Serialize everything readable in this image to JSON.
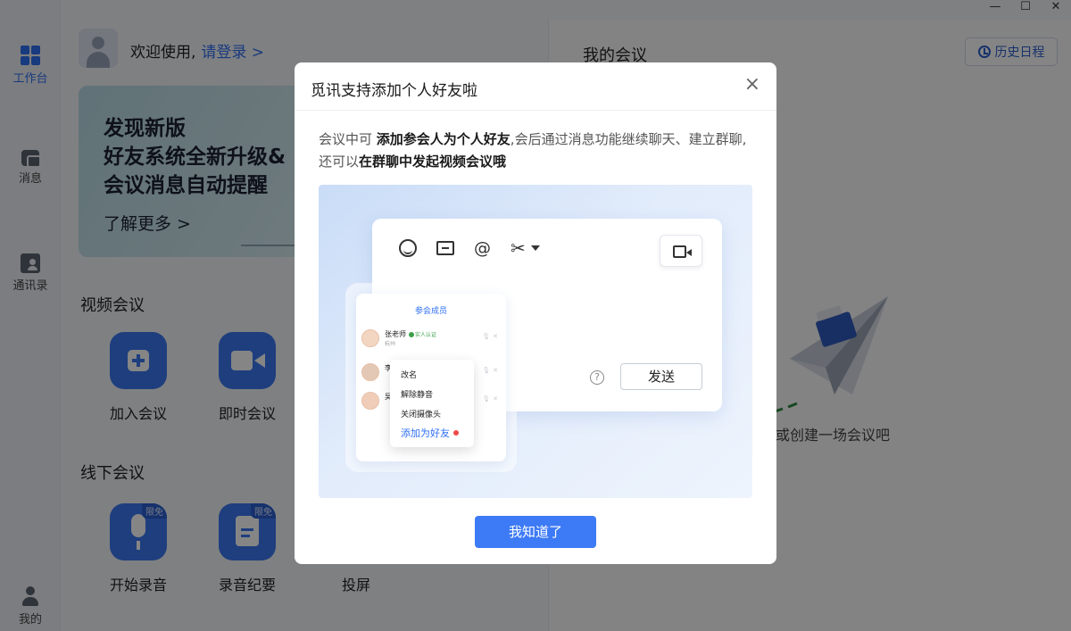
{
  "window": {
    "minimize": "—",
    "maximize": "☐",
    "close": "✕"
  },
  "rail": {
    "items": [
      {
        "label": "工作台",
        "icon": "grid-icon",
        "active": true
      },
      {
        "label": "消息",
        "icon": "message-icon"
      },
      {
        "label": "通讯录",
        "icon": "contacts-icon"
      },
      {
        "label": "我的",
        "icon": "user-icon"
      }
    ]
  },
  "header": {
    "welcome": "欢迎使用,",
    "login_link": "请登录 >"
  },
  "banner": {
    "line1": "发现新版",
    "line2": "好友系统全新升级&",
    "line3": "会议消息自动提醒",
    "more": "了解更多 >"
  },
  "video_section": {
    "title": "视频会议",
    "tiles": [
      {
        "label": "加入会议"
      },
      {
        "label": "即时会议"
      }
    ]
  },
  "offline_section": {
    "title": "线下会议",
    "tiles": [
      {
        "label": "开始录音",
        "tag": "限免"
      },
      {
        "label": "录音纪要",
        "tag": "限免"
      },
      {
        "label": "投屏"
      }
    ]
  },
  "right_panel": {
    "title": "我的会议",
    "history_button": "历史日程",
    "empty_text": "或创建一场会议吧"
  },
  "modal": {
    "title": "觅讯支持添加个人好友啦",
    "close": "×",
    "desc_prefix": "会议中可 ",
    "desc_bold1": "添加参会人为个人好友",
    "desc_mid": ",会后通过消息功能继续聊天、建立群聊,还可以",
    "desc_bold2": "在群聊中发起视频会议哦",
    "illustration": {
      "toolbar_at": "@",
      "help": "?",
      "send": "发送",
      "members_title": "参会成员",
      "members": [
        {
          "name": "张老师",
          "verified": "实人认证",
          "location": "杭州"
        },
        {
          "name": "李"
        },
        {
          "name": "吴"
        }
      ],
      "context_menu": [
        "改名",
        "解除静音",
        "关闭摄像头"
      ],
      "context_add": "添加为好友"
    },
    "confirm": "我知道了"
  },
  "colors": {
    "primary": "#3d7af5",
    "accent_blue": "#2e6ff2",
    "overlay": "rgba(0,0,0,0.48)"
  }
}
